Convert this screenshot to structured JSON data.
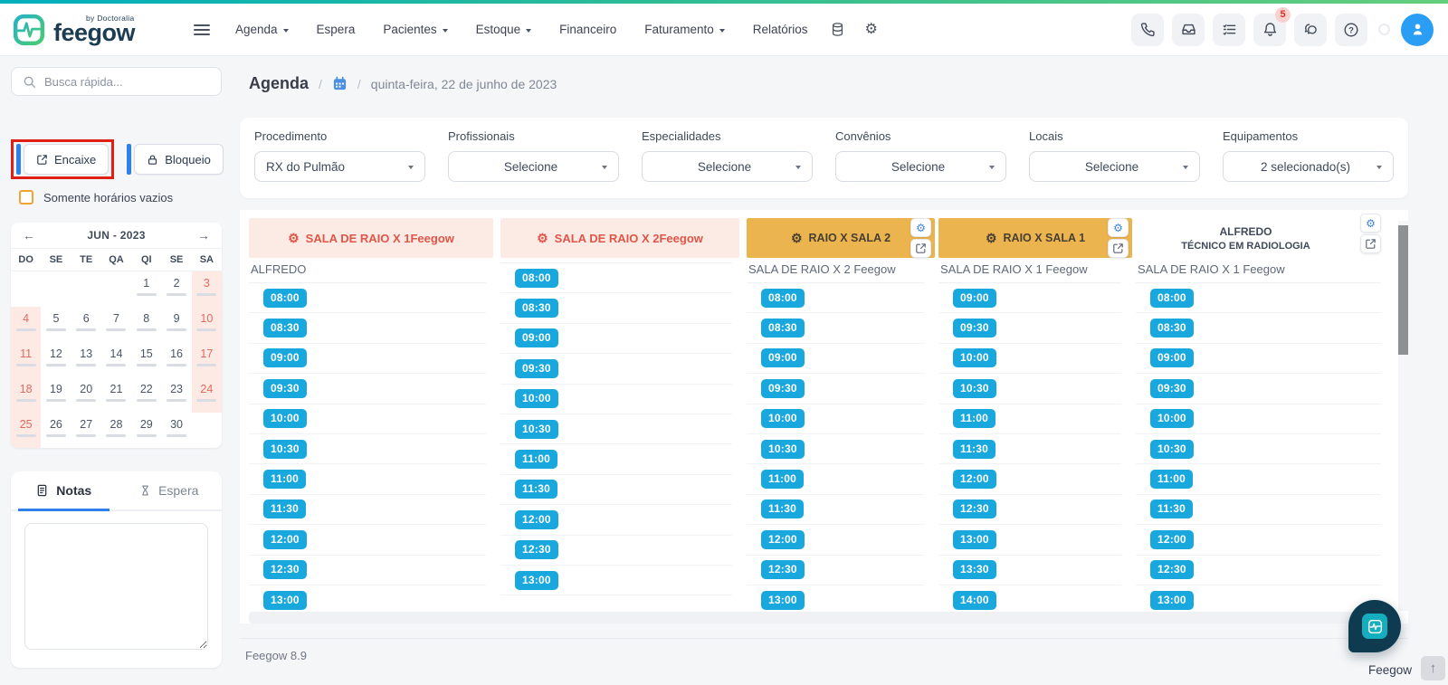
{
  "topbar": {
    "brand": {
      "name": "feegow",
      "by": "by Doctoralia"
    },
    "nav": [
      {
        "id": "agenda",
        "label": "Agenda",
        "caret": true
      },
      {
        "id": "espera",
        "label": "Espera",
        "caret": false
      },
      {
        "id": "pacientes",
        "label": "Pacientes",
        "caret": true
      },
      {
        "id": "estoque",
        "label": "Estoque",
        "caret": true
      },
      {
        "id": "financeiro",
        "label": "Financeiro",
        "caret": false
      },
      {
        "id": "faturamento",
        "label": "Faturamento",
        "caret": true
      },
      {
        "id": "relatorios",
        "label": "Relatórios",
        "caret": false
      }
    ],
    "notification_count": "5"
  },
  "sidebar": {
    "search_placeholder": "Busca rápida...",
    "encaixe_label": "Encaixe",
    "bloqueio_label": "Bloqueio",
    "checkbox_label": "Somente horários vazios",
    "calendar": {
      "title": "JUN - 2023",
      "weekdays": [
        "DO",
        "SE",
        "TE",
        "QA",
        "QI",
        "SE",
        "SA"
      ],
      "weeks": [
        [
          "",
          "",
          "",
          "",
          "1",
          "2",
          "3"
        ],
        [
          "4",
          "5",
          "6",
          "7",
          "8",
          "9",
          "10"
        ],
        [
          "11",
          "12",
          "13",
          "14",
          "15",
          "16",
          "17"
        ],
        [
          "18",
          "19",
          "20",
          "21",
          "22",
          "23",
          "24"
        ],
        [
          "25",
          "26",
          "27",
          "28",
          "29",
          "30",
          ""
        ]
      ]
    },
    "notes": {
      "tab_notas": "Notas",
      "tab_espera": "Espera"
    }
  },
  "breadcrumb": {
    "section": "Agenda",
    "date": "quinta-feira, 22 de junho de 2023"
  },
  "filters": [
    {
      "label": "Procedimento",
      "value": "RX do Pulmão",
      "align": "left"
    },
    {
      "label": "Profissionais",
      "value": "Selecione",
      "align": "center"
    },
    {
      "label": "Especialidades",
      "value": "Selecione",
      "align": "center"
    },
    {
      "label": "Convênios",
      "value": "Selecione",
      "align": "center"
    },
    {
      "label": "Locais",
      "value": "Selecione",
      "align": "center"
    },
    {
      "label": "Equipamentos",
      "value": "2 selecionado(s)",
      "align": "center"
    }
  ],
  "schedule": {
    "columns": [
      {
        "title": "SALA DE RAIO X 1Feegow",
        "style": "pink",
        "subtitle": "ALFREDO",
        "has_actions": false,
        "times": [
          "08:00",
          "08:30",
          "09:00",
          "09:30",
          "10:00",
          "10:30",
          "11:00",
          "11:30",
          "12:00",
          "12:30",
          "13:00"
        ]
      },
      {
        "title": "SALA DE RAIO X 2Feegow",
        "style": "pink",
        "subtitle": "",
        "has_actions": false,
        "times": [
          "08:00",
          "08:30",
          "09:00",
          "09:30",
          "10:00",
          "10:30",
          "11:00",
          "11:30",
          "12:00",
          "12:30",
          "13:00"
        ]
      },
      {
        "title": "RAIO X SALA 2",
        "style": "orange",
        "subtitle": "SALA DE RAIO X 2 Feegow",
        "has_actions": true,
        "times": [
          "08:00",
          "08:30",
          "09:00",
          "09:30",
          "10:00",
          "10:30",
          "11:00",
          "11:30",
          "12:00",
          "12:30",
          "13:00"
        ]
      },
      {
        "title": "RAIO X SALA 1",
        "style": "orange",
        "subtitle": "SALA DE RAIO X 1 Feegow",
        "has_actions": true,
        "times": [
          "09:00",
          "09:30",
          "10:00",
          "10:30",
          "11:00",
          "11:30",
          "12:00",
          "12:30",
          "13:00",
          "13:30",
          "14:00"
        ]
      },
      {
        "title": "ALFREDO",
        "title2": "TÉCNICO EM RADIOLOGIA",
        "style": "plain",
        "subtitle": "SALA DE RAIO X 1 Feegow",
        "has_actions": true,
        "times": [
          "08:00",
          "08:30",
          "09:00",
          "09:30",
          "10:00",
          "10:30",
          "11:00",
          "11:30",
          "12:00",
          "12:30",
          "13:00"
        ]
      }
    ]
  },
  "footer": {
    "version": "Feegow 8.9",
    "brand": "Feegow"
  },
  "colors": {
    "slot_blue": "#18a8dd",
    "pink_header_bg": "#fcebe4",
    "pink_header_text": "#df5649",
    "orange_header_bg": "#ecb44e",
    "accent_blue": "#2f80ed",
    "highlight_red": "#e01f15",
    "top_strip_gradient": [
      "#00afbd",
      "#64ce7c"
    ]
  }
}
